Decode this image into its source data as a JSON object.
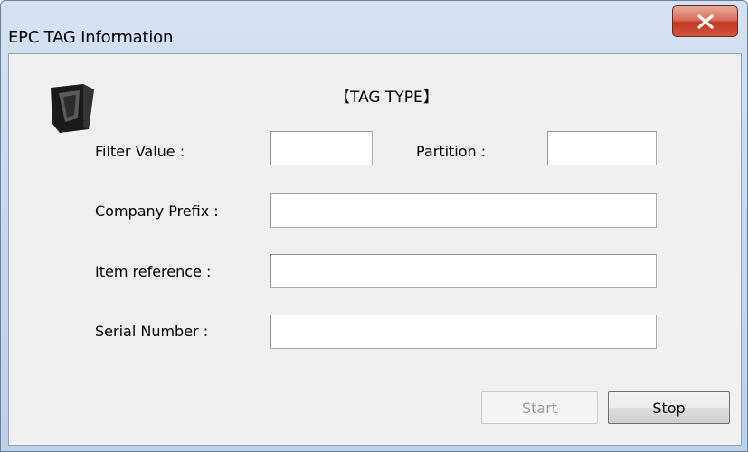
{
  "window": {
    "title": "EPC TAG Information",
    "close_icon": "close-x-icon",
    "logo_icon": "rfid-reader-icon"
  },
  "form": {
    "section_title": "【TAG TYPE】",
    "filter_value": {
      "label": "Filter Value :",
      "value": ""
    },
    "partition": {
      "label": "Partition :",
      "value": ""
    },
    "company_prefix": {
      "label": "Company Prefix :",
      "value": ""
    },
    "item_reference": {
      "label": "Item reference :",
      "value": ""
    },
    "serial_number": {
      "label": "Serial Number :",
      "value": ""
    }
  },
  "buttons": {
    "start_label": "Start",
    "start_enabled": false,
    "stop_label": "Stop"
  },
  "colors": {
    "close_button": "#c94a34",
    "client_bg": "#f0f0f0",
    "frame": "#c6d9ee",
    "disabled_text": "#9d9d9d"
  }
}
